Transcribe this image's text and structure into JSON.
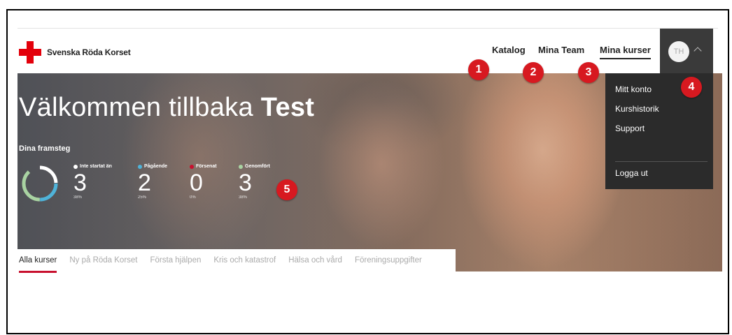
{
  "brand": {
    "name": "Svenska Röda Korset",
    "color": "#e3000b"
  },
  "nav": {
    "catalog": "Katalog",
    "teams": "Mina Team",
    "courses": "Mina kurser"
  },
  "user": {
    "initials": "TH"
  },
  "hero": {
    "welcome_prefix": "Välkommen tillbaka",
    "welcome_name": "Test",
    "progress_title": "Dina framsteg",
    "stats": [
      {
        "label": "Inte startat än",
        "value": "3",
        "percent": "38%",
        "color": "#ffffff"
      },
      {
        "label": "Pågående",
        "value": "2",
        "percent": "25%",
        "color": "#4fb3d9"
      },
      {
        "label": "Försenat",
        "value": "0",
        "percent": "0%",
        "color": "#c8102e"
      },
      {
        "label": "Genomfört",
        "value": "3",
        "percent": "38%",
        "color": "#a9d3a2"
      }
    ]
  },
  "tabs": [
    "Alla kurser",
    "Ny på Röda Korset",
    "Första hjälpen",
    "Kris och katastrof",
    "Hälsa och vård",
    "Föreningsuppgifter"
  ],
  "dropdown": {
    "items": [
      "Mitt konto",
      "Kurshistorik",
      "Support"
    ],
    "logout": "Logga ut"
  },
  "markers": [
    "1",
    "2",
    "3",
    "4",
    "5"
  ]
}
